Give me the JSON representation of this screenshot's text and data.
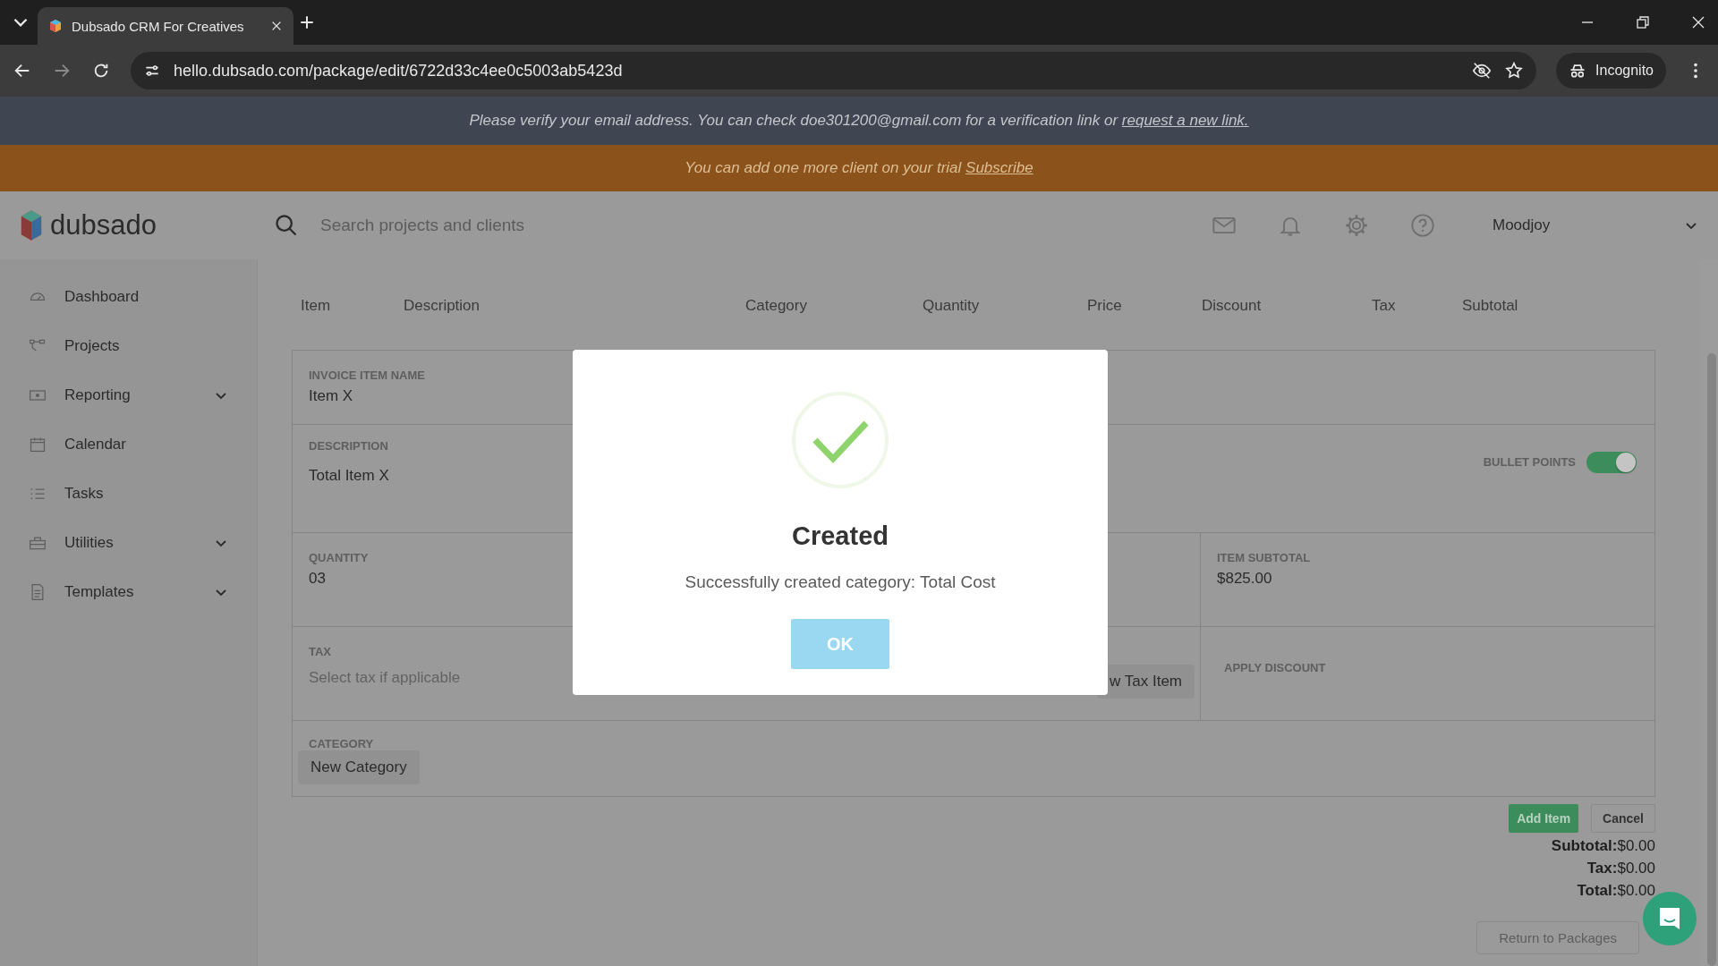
{
  "browser": {
    "tab_title": "Dubsado CRM For Creatives",
    "url": "hello.dubsado.com/package/edit/6722d33c4ee0c5003ab5423d",
    "profile": "Incognito"
  },
  "banners": [
    {
      "kind": "verify",
      "text": "Please verify your email address. You can check doe301200@gmail.com for a verification link or",
      "link": "request a new link."
    },
    {
      "kind": "trial",
      "text": "You can add one more client on your trial",
      "link": "Subscribe"
    }
  ],
  "header": {
    "logo": "dubsado",
    "search_placeholder": "Search projects and clients",
    "user": "Moodjoy"
  },
  "sidebar": {
    "items": [
      {
        "label": "Dashboard",
        "expandable": false
      },
      {
        "label": "Projects",
        "expandable": false
      },
      {
        "label": "Reporting",
        "expandable": true
      },
      {
        "label": "Calendar",
        "expandable": false
      },
      {
        "label": "Tasks",
        "expandable": false
      },
      {
        "label": "Utilities",
        "expandable": true
      },
      {
        "label": "Templates",
        "expandable": true
      }
    ]
  },
  "table": {
    "columns": [
      "Item",
      "Description",
      "Category",
      "Quantity",
      "Price",
      "Discount",
      "Tax",
      "Subtotal"
    ]
  },
  "form": {
    "item_name": {
      "label": "INVOICE ITEM NAME",
      "value": "Item X"
    },
    "description": {
      "label": "DESCRIPTION",
      "value": "Total Item X",
      "bullet_points": {
        "label": "BULLET POINTS",
        "on": true
      }
    },
    "quantity": {
      "label": "QUANTITY",
      "value": "03"
    },
    "item_subtotal": {
      "label": "ITEM SUBTOTAL",
      "value": "$825.00"
    },
    "tax": {
      "label": "TAX",
      "placeholder": "Select tax if applicable",
      "button": "w Tax Item"
    },
    "apply_discount": {
      "label": "APPLY DISCOUNT"
    },
    "category": {
      "label": "CATEGORY",
      "button": "New Category"
    }
  },
  "actions": {
    "add_item": "Add Item",
    "cancel": "Cancel"
  },
  "totals": [
    {
      "label": "Subtotal:",
      "value": "$0.00"
    },
    {
      "label": "Tax:",
      "value": "$0.00"
    },
    {
      "label": "Total:",
      "value": "$0.00"
    }
  ],
  "return_button": "Return to Packages",
  "modal": {
    "title": "Created",
    "message": "Successfully created category: Total Cost",
    "button": "OK"
  }
}
